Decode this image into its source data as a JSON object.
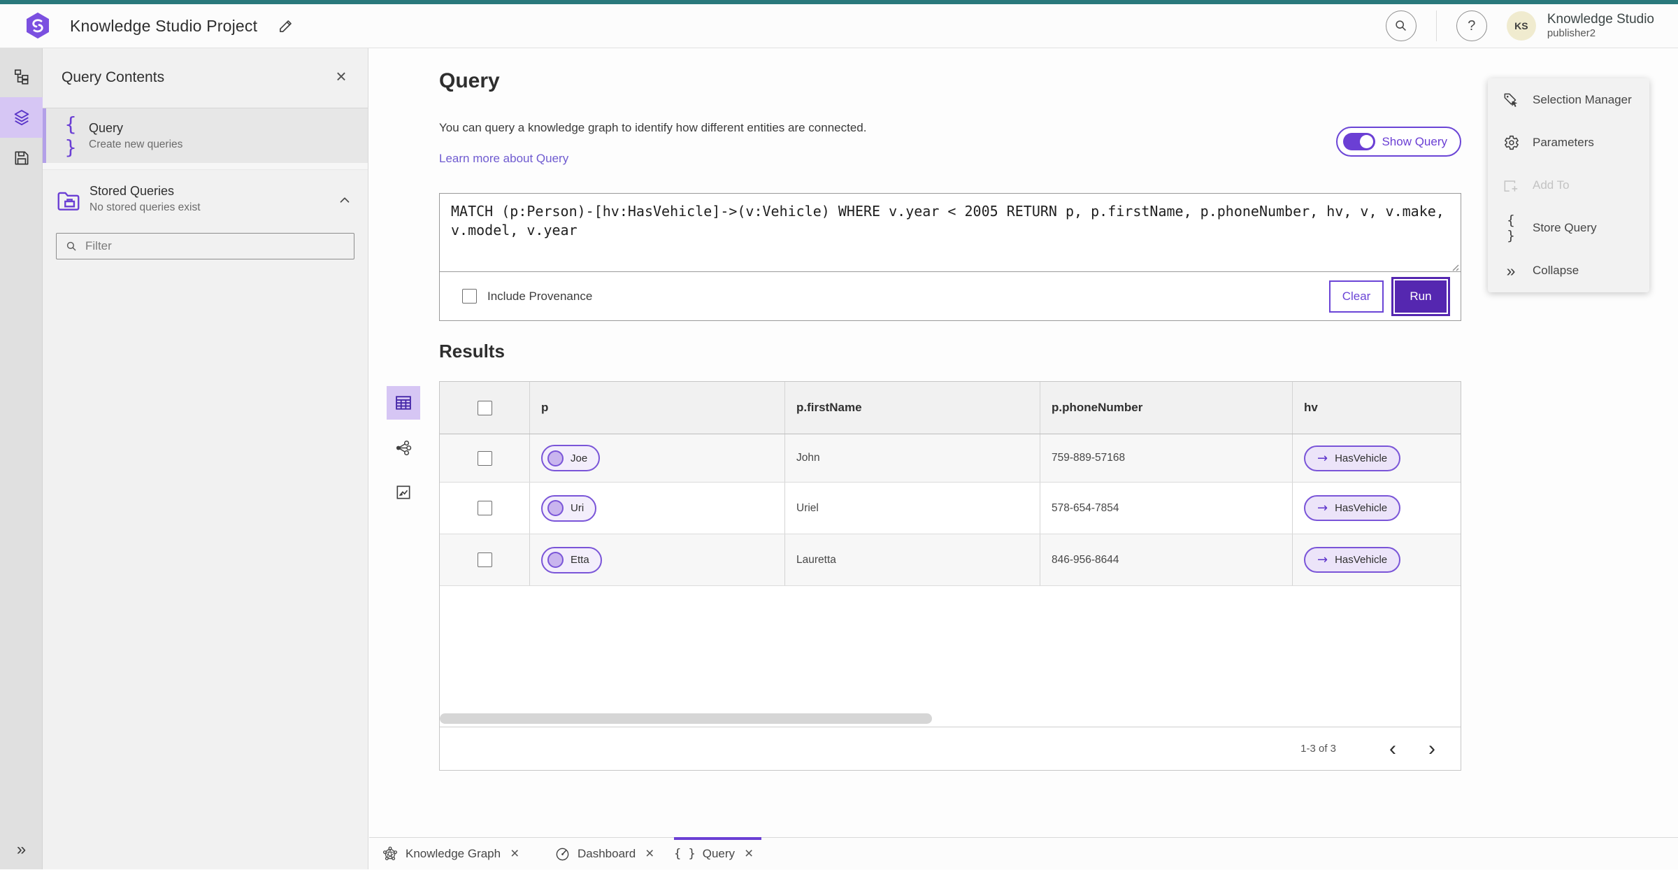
{
  "icons": {
    "braces": "{ }",
    "close": "×",
    "question_mark": "?",
    "collapse_chevrons": "»",
    "expand_chevrons": "»",
    "arrow_right": "→",
    "chevron_left": "‹",
    "chevron_right": "›"
  },
  "colors": {
    "teal_bar": "#2a797c",
    "accent_purple": "#6b3fd4",
    "run_purple": "#5527b0",
    "active_icon_bg": "#d6c6f4",
    "avatar_bg": "#f0ebcf"
  },
  "top_bar": {
    "title": "Knowledge Studio Project",
    "user_name": "Knowledge Studio",
    "user_role": "publisher2",
    "avatar_initials": "KS"
  },
  "contents_panel": {
    "title": "Query Contents",
    "query_item": {
      "title": "Query",
      "subtitle": "Create new queries"
    },
    "stored_queries": {
      "title": "Stored Queries",
      "subtitle": "No stored queries exist"
    },
    "filter_placeholder": "Filter"
  },
  "query_section": {
    "title": "Query",
    "description": "You can query a knowledge graph to identify how different entities are connected.",
    "learn_more_label": "Learn more about Query",
    "show_query_label": "Show Query",
    "query_text": "MATCH (p:Person)-[hv:HasVehicle]->(v:Vehicle) WHERE v.year < 2005 RETURN p, p.firstName, p.phoneNumber, hv, v, v.make, v.model, v.year",
    "include_provenance_label": "Include Provenance",
    "clear_label": "Clear",
    "run_label": "Run"
  },
  "results": {
    "title": "Results",
    "columns": [
      "p",
      "p.firstName",
      "p.phoneNumber",
      "hv"
    ],
    "rows": [
      {
        "p": "Joe",
        "firstName": "John",
        "phone": "759-889-57168",
        "hv": "HasVehicle"
      },
      {
        "p": "Uri",
        "firstName": "Uriel",
        "phone": "578-654-7854",
        "hv": "HasVehicle"
      },
      {
        "p": "Etta",
        "firstName": "Lauretta",
        "phone": "846-956-8644",
        "hv": "HasVehicle"
      }
    ],
    "pagination_label": "1-3 of 3"
  },
  "side_actions": {
    "selection_manager": "Selection Manager",
    "parameters": "Parameters",
    "add_to": "Add To",
    "store_query": "Store Query",
    "collapse": "Collapse"
  },
  "bottom_tabs": {
    "knowledge_graph": "Knowledge Graph",
    "dashboard": "Dashboard",
    "query": "Query"
  }
}
